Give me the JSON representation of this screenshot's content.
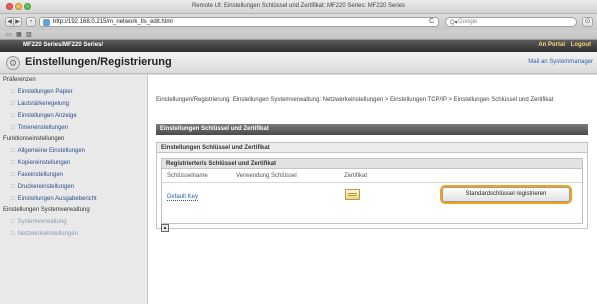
{
  "window": {
    "title": "Remote UI: Einstellungen Schlüssel und Zertifikat: MF220 Series: MF220 Series",
    "url": "http://192.168.0.215/m_network_tls_edit.html",
    "search_placeholder": "Google",
    "reload_icon": "C"
  },
  "header": {
    "device": "MF220 Series/MF220 Series/",
    "portal": "An Portal",
    "logout": "Logout"
  },
  "section": {
    "title": "Einstellungen/Registrierung",
    "mail_link": "Mail an Systemmanager"
  },
  "sidebar": {
    "groups": [
      {
        "label": "Präferenzen",
        "items": [
          {
            "label": "Einstellungen Papier",
            "dim": false
          },
          {
            "label": "Lautstärkeregelung",
            "dim": false
          },
          {
            "label": "Einstellungen Anzeige",
            "dim": false
          },
          {
            "label": "Timereinstellungen",
            "dim": false
          }
        ]
      },
      {
        "label": "Funktionseinstellungen",
        "items": [
          {
            "label": "Allgemeine Einstellungen",
            "dim": false
          },
          {
            "label": "Kopiereinstellungen",
            "dim": false
          },
          {
            "label": "Faxeinstellungen",
            "dim": false
          },
          {
            "label": "Druckereinstellungen",
            "dim": false
          },
          {
            "label": "Einstellungen Ausgabebericht",
            "dim": false
          }
        ]
      },
      {
        "label": "Einstellungen Systemverwaltung",
        "items": [
          {
            "label": "Systemverwaltung",
            "dim": true
          },
          {
            "label": "Netzwerkeinstellungen",
            "dim": true
          }
        ]
      }
    ]
  },
  "main": {
    "breadcrumb": "Einstellungen/Registrierung: Einstellungen Systemverwaltung: Netzwerkeinstellungen > Einstellungen TCP/IP > Einstellungen Schlüssel und Zertifikat",
    "panel_title": "Einstellungen Schlüssel und Zertifikat",
    "box_title": "Einstellungen Schlüssel und Zertifikat",
    "registered_title": "Registrierter/s Schlüssel und Zertifikat",
    "columns": {
      "key_name": "Schlüsselname",
      "key_usage": "Verwendung Schlüssel",
      "certificate": "Zertifikat"
    },
    "row": {
      "key_name": "Default Key"
    },
    "register_button": "Standardschlüssel registrieren"
  },
  "colors": {
    "accent_orange": "#f0a21b",
    "link_blue": "#2a5fb0",
    "header_dark": "#3a3a3a"
  }
}
